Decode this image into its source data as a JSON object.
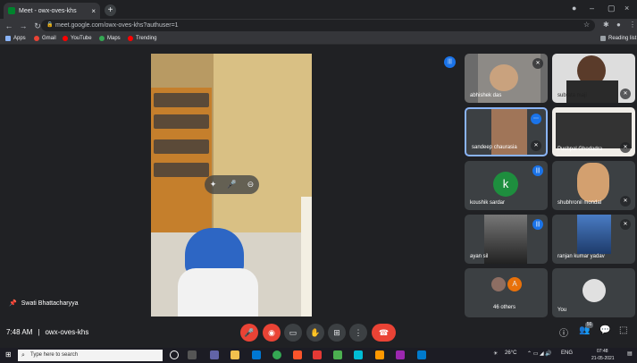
{
  "browser": {
    "tab_title": "Meet - owx-oves-khs",
    "new_tab_icon": "plus-icon",
    "address": "meet.google.com/owx-oves-khs?authuser=1",
    "bookmarks": [
      "Apps",
      "Gmail",
      "YouTube",
      "Maps",
      "Trending"
    ],
    "reading_list": "Reading list"
  },
  "meeting": {
    "time": "7:48 AM",
    "separator": "|",
    "code": "owx-oves-khs",
    "presenter": "Swati Bhattacharyya",
    "participant_count": "56"
  },
  "participants": [
    {
      "name": "abhishek das",
      "badge": "mic-off-icon"
    },
    {
      "name": "subrata maji",
      "badge": "mic-off-icon"
    },
    {
      "name": "sandeep chaurasia",
      "badge": "more-icon"
    },
    {
      "name": "Pushpal Ghodadra",
      "badge": "mic-off-icon"
    },
    {
      "name": "koushik sardar",
      "badge": "speaking-icon",
      "initial": "k"
    },
    {
      "name": "shubhronil mondal",
      "badge": "mic-off-icon"
    },
    {
      "name": "ayan sil",
      "badge": "speaking-icon"
    },
    {
      "name": "ranjan kumar yadav",
      "badge": "mic-off-icon"
    },
    {
      "name": "46 others",
      "initials": [
        "A"
      ]
    },
    {
      "name": "You"
    }
  ],
  "taskbar": {
    "search_placeholder": "Type here to search",
    "weather": "26°C",
    "lang": "ENG",
    "clock_time": "07:48",
    "clock_date": "21-05-2021"
  },
  "colors": {
    "accent": "#1a73e8",
    "danger": "#ea4335",
    "bg": "#202124"
  }
}
